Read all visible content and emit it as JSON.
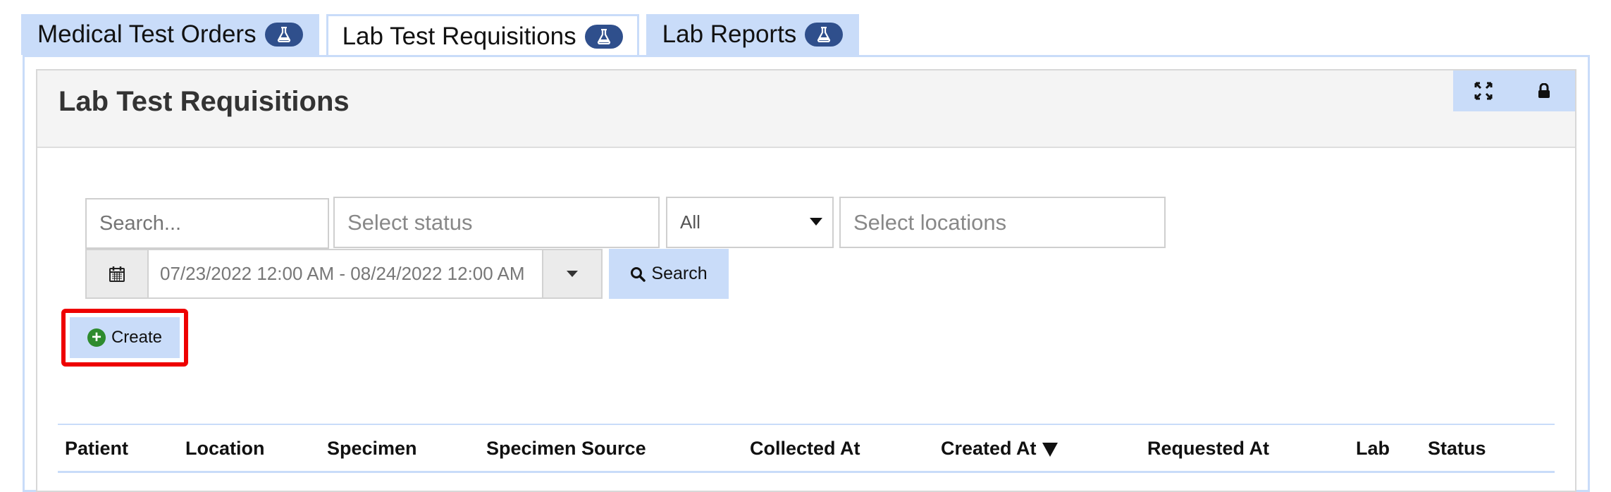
{
  "tabs": [
    {
      "label": "Medical Test Orders",
      "icon": "flask-icon"
    },
    {
      "label": "Lab Test Requisitions",
      "icon": "flask-icon"
    },
    {
      "label": "Lab Reports",
      "icon": "flask-icon"
    }
  ],
  "panel": {
    "title": "Lab Test Requisitions",
    "tools": [
      "expand-icon",
      "lock-icon"
    ]
  },
  "filters": {
    "search_placeholder": "Search...",
    "status_placeholder": "Select status",
    "all_value": "All",
    "locations_placeholder": "Select locations",
    "date_range": "07/23/2022 12:00 AM - 08/24/2022 12:00 AM",
    "search_label": "Search"
  },
  "create_label": "Create",
  "columns": [
    "Patient",
    "Location",
    "Specimen",
    "Specimen Source",
    "Collected At",
    "Created At",
    "Requested At",
    "Lab",
    "Status"
  ],
  "colors": {
    "accent": "#c9dcf9",
    "badge": "#2f4f8c",
    "highlight": "#ee0000",
    "create_icon": "#2e8b2e"
  }
}
